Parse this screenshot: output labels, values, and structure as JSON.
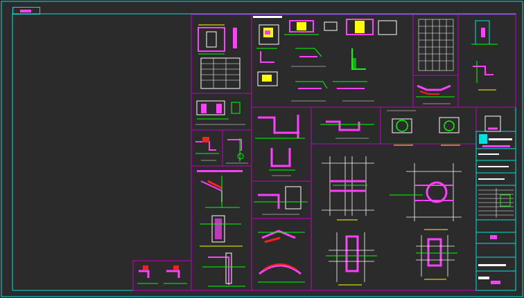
{
  "sheet": {
    "title": "",
    "background": "#2b2b2b",
    "frame_color": "#00e0e0",
    "panel_color": "#c000c0",
    "line_color": "#ffffff",
    "accent_colors": [
      "#ff40ff",
      "#00ff00",
      "#ffff00",
      "#ff2020",
      "#00e0e0"
    ]
  },
  "title_block": {
    "label": ""
  }
}
